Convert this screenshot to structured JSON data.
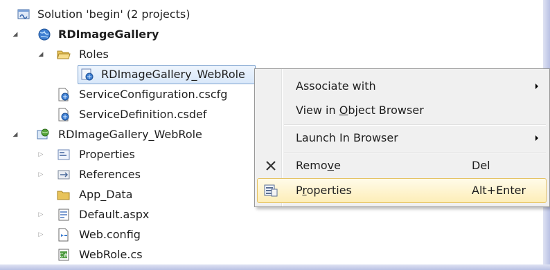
{
  "tree": {
    "solution": "Solution 'begin' (2 projects)",
    "cloud_project": "RDImageGallery",
    "roles_folder": "Roles",
    "selected_role": "RDImageGallery_WebRole",
    "service_config": "ServiceConfiguration.cscfg",
    "service_def": "ServiceDefinition.csdef",
    "web_project": "RDImageGallery_WebRole",
    "properties": "Properties",
    "references": "References",
    "app_data": "App_Data",
    "default_aspx": "Default.aspx",
    "web_config": "Web.config",
    "webrole_cs": "WebRole.cs"
  },
  "menu": {
    "associate": "Associate with",
    "object_browser_pre": "View in ",
    "object_browser_key": "O",
    "object_browser_post": "bject Browser",
    "launch": "Launch In Browser",
    "remove_pre": "Remo",
    "remove_key": "v",
    "remove_post": "e",
    "remove_shortcut": "Del",
    "properties_pre": "P",
    "properties_key": "r",
    "properties_post": "operties",
    "properties_shortcut": "Alt+Enter"
  }
}
